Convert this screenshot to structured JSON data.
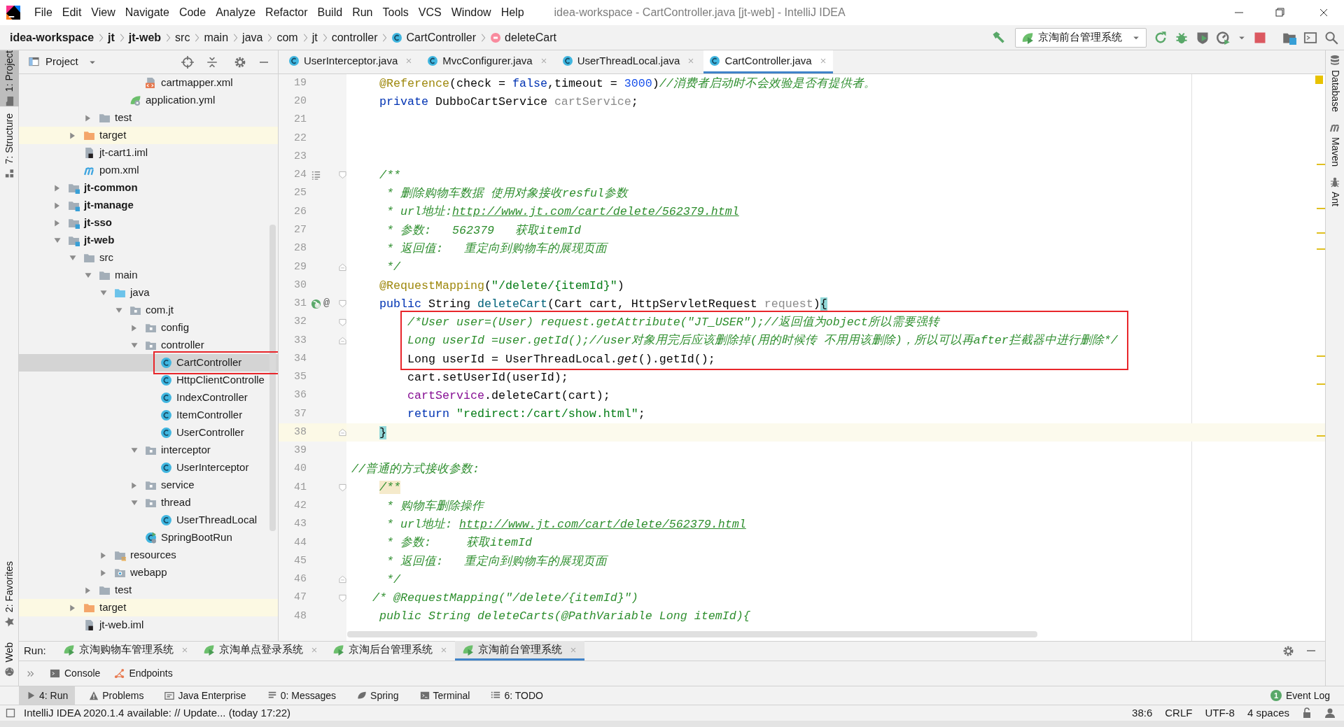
{
  "window": {
    "title": "idea-workspace - CartController.java [jt-web] - IntelliJ IDEA"
  },
  "menu": [
    "File",
    "Edit",
    "View",
    "Navigate",
    "Code",
    "Analyze",
    "Refactor",
    "Build",
    "Run",
    "Tools",
    "VCS",
    "Window",
    "Help"
  ],
  "breadcrumbs": [
    {
      "label": "idea-workspace",
      "kind": "module"
    },
    {
      "label": "jt",
      "kind": "module"
    },
    {
      "label": "jt-web",
      "kind": "module"
    },
    {
      "label": "src",
      "kind": "dir"
    },
    {
      "label": "main",
      "kind": "dir"
    },
    {
      "label": "java",
      "kind": "dir"
    },
    {
      "label": "com",
      "kind": "dir"
    },
    {
      "label": "jt",
      "kind": "dir"
    },
    {
      "label": "controller",
      "kind": "dir"
    },
    {
      "label": "CartController",
      "kind": "class"
    },
    {
      "label": "deleteCart",
      "kind": "method"
    }
  ],
  "run_config": {
    "label": "京淘前台管理系统"
  },
  "left_tools": [
    {
      "label": "1: Project",
      "kind": "project",
      "selected": true
    },
    {
      "label": "7: Structure",
      "kind": "structure",
      "selected": false
    },
    {
      "label": "2: Favorites",
      "kind": "favorites",
      "selected": false
    },
    {
      "label": "Web",
      "kind": "web",
      "selected": false
    }
  ],
  "right_tools": [
    {
      "label": "Database",
      "kind": "database"
    },
    {
      "label": "Maven",
      "kind": "maven"
    },
    {
      "label": "Ant",
      "kind": "ant"
    }
  ],
  "project_panel": {
    "title": "Project",
    "tree": [
      {
        "children": [
          {
            "children": [
              {
                "children": [
                  {
                    "children": [
                      {
                        "children": [
                          {
                            "label": "cartmapper.xml",
                            "kind": "xml",
                            "selected": false
                          }
                        ]
                      },
                      {
                        "label": "application.yml",
                        "kind": "yml",
                        "selected": false
                      }
                    ]
                  }
                ]
              },
              {
                "label": "test",
                "kind": "folder",
                "expanded": false,
                "selected": false
              }
            ]
          },
          {
            "label": "target",
            "kind": "excluded",
            "expanded": false,
            "selected": false
          },
          {
            "label": "jt-cart1.iml",
            "kind": "iml",
            "selected": false
          },
          {
            "label": "pom.xml",
            "kind": "maven",
            "selected": false
          }
        ]
      },
      {
        "label": "jt-common",
        "kind": "module",
        "expanded": false,
        "selected": false
      },
      {
        "label": "jt-manage",
        "kind": "module",
        "expanded": false,
        "selected": false
      },
      {
        "label": "jt-sso",
        "kind": "module",
        "expanded": false,
        "selected": false
      },
      {
        "label": "jt-web",
        "kind": "module",
        "expanded": true,
        "selected": false,
        "children": [
          {
            "label": "src",
            "kind": "folder",
            "expanded": true,
            "selected": false,
            "children": [
              {
                "label": "main",
                "kind": "folder",
                "expanded": true,
                "selected": false,
                "children": [
                  {
                    "label": "java",
                    "kind": "source",
                    "expanded": true,
                    "selected": false,
                    "children": [
                      {
                        "label": "com.jt",
                        "kind": "package",
                        "expanded": true,
                        "selected": false,
                        "children": [
                          {
                            "label": "config",
                            "kind": "package",
                            "expanded": false,
                            "selected": false
                          },
                          {
                            "label": "controller",
                            "kind": "package",
                            "expanded": true,
                            "selected": false,
                            "children": [
                              {
                                "label": "CartController",
                                "kind": "class",
                                "selected": true,
                                "boxed": true
                              },
                              {
                                "label": "HttpClientControlle",
                                "kind": "class",
                                "selected": false
                              },
                              {
                                "label": "IndexController",
                                "kind": "class",
                                "selected": false
                              },
                              {
                                "label": "ItemController",
                                "kind": "class",
                                "selected": false
                              },
                              {
                                "label": "UserController",
                                "kind": "class",
                                "selected": false
                              }
                            ]
                          },
                          {
                            "label": "interceptor",
                            "kind": "package",
                            "expanded": true,
                            "selected": false,
                            "children": [
                              {
                                "label": "UserInterceptor",
                                "kind": "class",
                                "selected": false
                              }
                            ]
                          },
                          {
                            "label": "service",
                            "kind": "package",
                            "expanded": false,
                            "selected": false
                          },
                          {
                            "label": "thread",
                            "kind": "package",
                            "expanded": true,
                            "selected": false,
                            "children": [
                              {
                                "label": "UserThreadLocal",
                                "kind": "class",
                                "selected": false
                              }
                            ]
                          },
                          {
                            "label": "SpringBootRun",
                            "kind": "spring-class",
                            "selected": false
                          }
                        ]
                      }
                    ]
                  },
                  {
                    "label": "resources",
                    "kind": "resources",
                    "expanded": false,
                    "selected": false
                  },
                  {
                    "label": "webapp",
                    "kind": "webapp",
                    "expanded": false,
                    "selected": false
                  }
                ]
              },
              {
                "label": "test",
                "kind": "folder",
                "expanded": false,
                "selected": false
              }
            ]
          },
          {
            "label": "target",
            "kind": "excluded",
            "expanded": false,
            "selected": false
          },
          {
            "label": "jt-web.iml",
            "kind": "iml",
            "selected": false
          }
        ]
      }
    ]
  },
  "tabs": [
    {
      "label": "UserInterceptor.java",
      "selected": false
    },
    {
      "label": "MvcConfigurer.java",
      "selected": false
    },
    {
      "label": "UserThreadLocal.java",
      "selected": false
    },
    {
      "label": "CartController.java",
      "selected": true
    }
  ],
  "editor": {
    "blocks": [
      {
        "lines": [
          {
            "number": "19",
            "tokens": [
              {
                "kind": "ann",
                "text": "    @Reference"
              },
              {
                "kind": "p",
                "text": "(check = "
              },
              {
                "kind": "kw",
                "text": "false"
              },
              {
                "kind": "p",
                "text": ",timeout = "
              },
              {
                "kind": "num",
                "text": "3000"
              },
              {
                "kind": "p",
                "text": ")"
              },
              {
                "kind": "cm",
                "text": "//消费者启动时不会效验是否有提供者。"
              }
            ]
          },
          {
            "number": "20",
            "tokens": [
              {
                "kind": "kw",
                "text": "    private"
              },
              {
                "kind": "p",
                "text": " DubboCartService "
              },
              {
                "kind": "dim",
                "text": "cartService"
              },
              {
                "kind": "p",
                "text": ";"
              }
            ]
          },
          {
            "number": "21"
          },
          {
            "number": "22"
          },
          {
            "number": "23"
          },
          {
            "number": "24",
            "gutter_icons": [
              {
                "kind": "doc"
              }
            ],
            "fold_open": true,
            "tokens": [
              {
                "kind": "cm",
                "text": "    /**"
              }
            ]
          },
          {
            "number": "25",
            "tokens": [
              {
                "kind": "cm",
                "text": "     * 删除购物车数据 使用对象接收resful参数"
              }
            ]
          },
          {
            "number": "26",
            "tokens": [
              {
                "kind": "cm",
                "text": "     * url地址:"
              },
              {
                "kind": "link",
                "text": "http://www.jt.com/cart/delete/562379.html"
              }
            ]
          },
          {
            "number": "27",
            "tokens": [
              {
                "kind": "cm",
                "text": "     * 参数:   562379   获取itemId"
              }
            ]
          },
          {
            "number": "28",
            "tokens": [
              {
                "kind": "cm",
                "text": "     * 返回值:   重定向到购物车的展现页面"
              }
            ]
          },
          {
            "number": "29",
            "fold_close": true,
            "tokens": [
              {
                "kind": "cm",
                "text": "     */"
              }
            ]
          },
          {
            "number": "30",
            "tokens": [
              {
                "kind": "ann",
                "text": "    @RequestMapping"
              },
              {
                "kind": "p",
                "text": "("
              },
              {
                "kind": "str",
                "text": "\"/delete/{itemId}\""
              },
              {
                "kind": "p",
                "text": ")"
              }
            ]
          },
          {
            "number": "31",
            "gutter_icons": [
              {
                "kind": "bean"
              }
            ],
            "gutter_text": "@",
            "fold_open": true,
            "tokens": [
              {
                "kind": "kw",
                "text": "    public"
              },
              {
                "kind": "p",
                "text": " String "
              },
              {
                "kind": "fn",
                "text": "deleteCart"
              },
              {
                "kind": "p",
                "text": "(Cart cart, HttpServletRequest "
              },
              {
                "kind": "dim",
                "text": "request"
              },
              {
                "kind": "p",
                "text": ")"
              },
              {
                "kind": "brace",
                "text": "{"
              }
            ]
          }
        ]
      },
      {
        "boxed": true,
        "lines": [
          {
            "number": "32",
            "fold_open": true,
            "tokens": [
              {
                "kind": "cm",
                "text": "        /*User user=(User) request.getAttribute(\"JT_USER\");//返回值为object所以需要强转"
              }
            ]
          },
          {
            "number": "33",
            "fold_close": true,
            "tokens": [
              {
                "kind": "cm",
                "text": "        Long userId =user.getId();//user对象用完后应该删除掉(用的时候传 不用用该删除)，所以可以再after拦截器中进行删除*/"
              }
            ]
          },
          {
            "number": "34",
            "tokens": [
              {
                "kind": "p",
                "text": "        Long userId = UserThreadLocal."
              },
              {
                "kind": "st",
                "text": "get"
              },
              {
                "kind": "p",
                "text": "().getId();"
              }
            ]
          }
        ]
      },
      {
        "lines": [
          {
            "number": "35",
            "tokens": [
              {
                "kind": "p",
                "text": "        cart.setUserId(userId);"
              }
            ]
          },
          {
            "number": "36",
            "tokens": [
              {
                "kind": "fld",
                "text": "        cartService"
              },
              {
                "kind": "p",
                "text": ".deleteCart(cart);"
              }
            ]
          },
          {
            "number": "37",
            "tokens": [
              {
                "kind": "kw",
                "text": "        return"
              },
              {
                "kind": "str",
                "text": " \"redirect:/cart/show.html\""
              },
              {
                "kind": "p",
                "text": ";"
              }
            ]
          },
          {
            "number": "38",
            "current": true,
            "fold_close": true,
            "tokens": [
              {
                "kind": "brace",
                "text": "    }"
              }
            ]
          },
          {
            "number": "39"
          },
          {
            "number": "40",
            "tokens": [
              {
                "kind": "cm",
                "text": "//普通的方式接收参数:"
              }
            ]
          },
          {
            "number": "41",
            "fold_open": true,
            "tokens": [
              {
                "kind": "cmhl",
                "text": "    /**"
              }
            ]
          },
          {
            "number": "42",
            "tokens": [
              {
                "kind": "cm",
                "text": "     * 购物车删除操作"
              }
            ]
          },
          {
            "number": "43",
            "tokens": [
              {
                "kind": "cm",
                "text": "     * url地址: "
              },
              {
                "kind": "link",
                "text": "http://www.jt.com/cart/delete/562379.html"
              }
            ]
          },
          {
            "number": "44",
            "tokens": [
              {
                "kind": "cm",
                "text": "     * 参数:     获取itemId"
              }
            ]
          },
          {
            "number": "45",
            "tokens": [
              {
                "kind": "cm",
                "text": "     * 返回值:   重定向到购物车的展现页面"
              }
            ]
          },
          {
            "number": "46",
            "fold_close": true,
            "tokens": [
              {
                "kind": "cm",
                "text": "     */"
              }
            ]
          },
          {
            "number": "47",
            "fold_open": true,
            "tokens": [
              {
                "kind": "cm",
                "text": "   /* @RequestMapping(\"/delete/{itemId}\")"
              }
            ]
          },
          {
            "number": "48",
            "tokens": [
              {
                "kind": "cm",
                "text": "    public String deleteCarts(@PathVariable Long itemId){"
              }
            ]
          }
        ]
      }
    ]
  },
  "run_panel": {
    "label": "Run:",
    "tabs": [
      {
        "label": "京淘购物车管理系统",
        "selected": false
      },
      {
        "label": "京淘单点登录系统",
        "selected": false
      },
      {
        "label": "京淘后台管理系统",
        "selected": false
      },
      {
        "label": "京淘前台管理系统",
        "selected": true
      }
    ],
    "subtabs": [
      {
        "label": "Console",
        "kind": "console"
      },
      {
        "label": "Endpoints",
        "kind": "endpoints"
      }
    ]
  },
  "tool_strip": {
    "items": [
      {
        "label": "4: Run",
        "kind": "run",
        "selected": true
      },
      {
        "label": "Problems",
        "kind": "problems",
        "selected": false
      },
      {
        "label": "Java Enterprise",
        "kind": "javaee",
        "selected": false
      },
      {
        "label": "0: Messages",
        "kind": "messages",
        "selected": false
      },
      {
        "label": "Spring",
        "kind": "spring",
        "selected": false
      },
      {
        "label": "Terminal",
        "kind": "terminal",
        "selected": false
      },
      {
        "label": "6: TODO",
        "kind": "todo",
        "selected": false
      }
    ],
    "event_log": {
      "label": "Event Log",
      "badge": "1"
    }
  },
  "status_bar": {
    "message": "IntelliJ IDEA 2020.1.4 available: // Update... (today 17:22)",
    "position": "38:6",
    "line_separator": "CRLF",
    "encoding": "UTF-8",
    "indent": "4 spaces"
  }
}
